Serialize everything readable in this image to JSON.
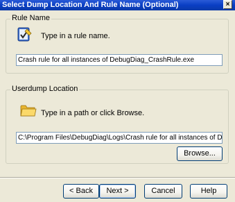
{
  "window": {
    "title": "Select Dump Location And Rule Name (Optional)",
    "close_glyph": "×"
  },
  "rule_name_group": {
    "legend": "Rule Name",
    "icon": "rename-icon",
    "hint": "Type in a rule name.",
    "value": "Crash rule for all instances of DebugDiag_CrashRule.exe"
  },
  "userdump_group": {
    "legend": "Userdump Location",
    "icon": "folder-icon",
    "hint": "Type in a path or click Browse.",
    "value": "C:\\Program Files\\DebugDiag\\Logs\\Crash rule for all instances of DebugDiag_Cra",
    "browse_label": "Browse..."
  },
  "buttons": {
    "back": "< Back",
    "next": "Next >",
    "cancel": "Cancel",
    "help": "Help"
  }
}
